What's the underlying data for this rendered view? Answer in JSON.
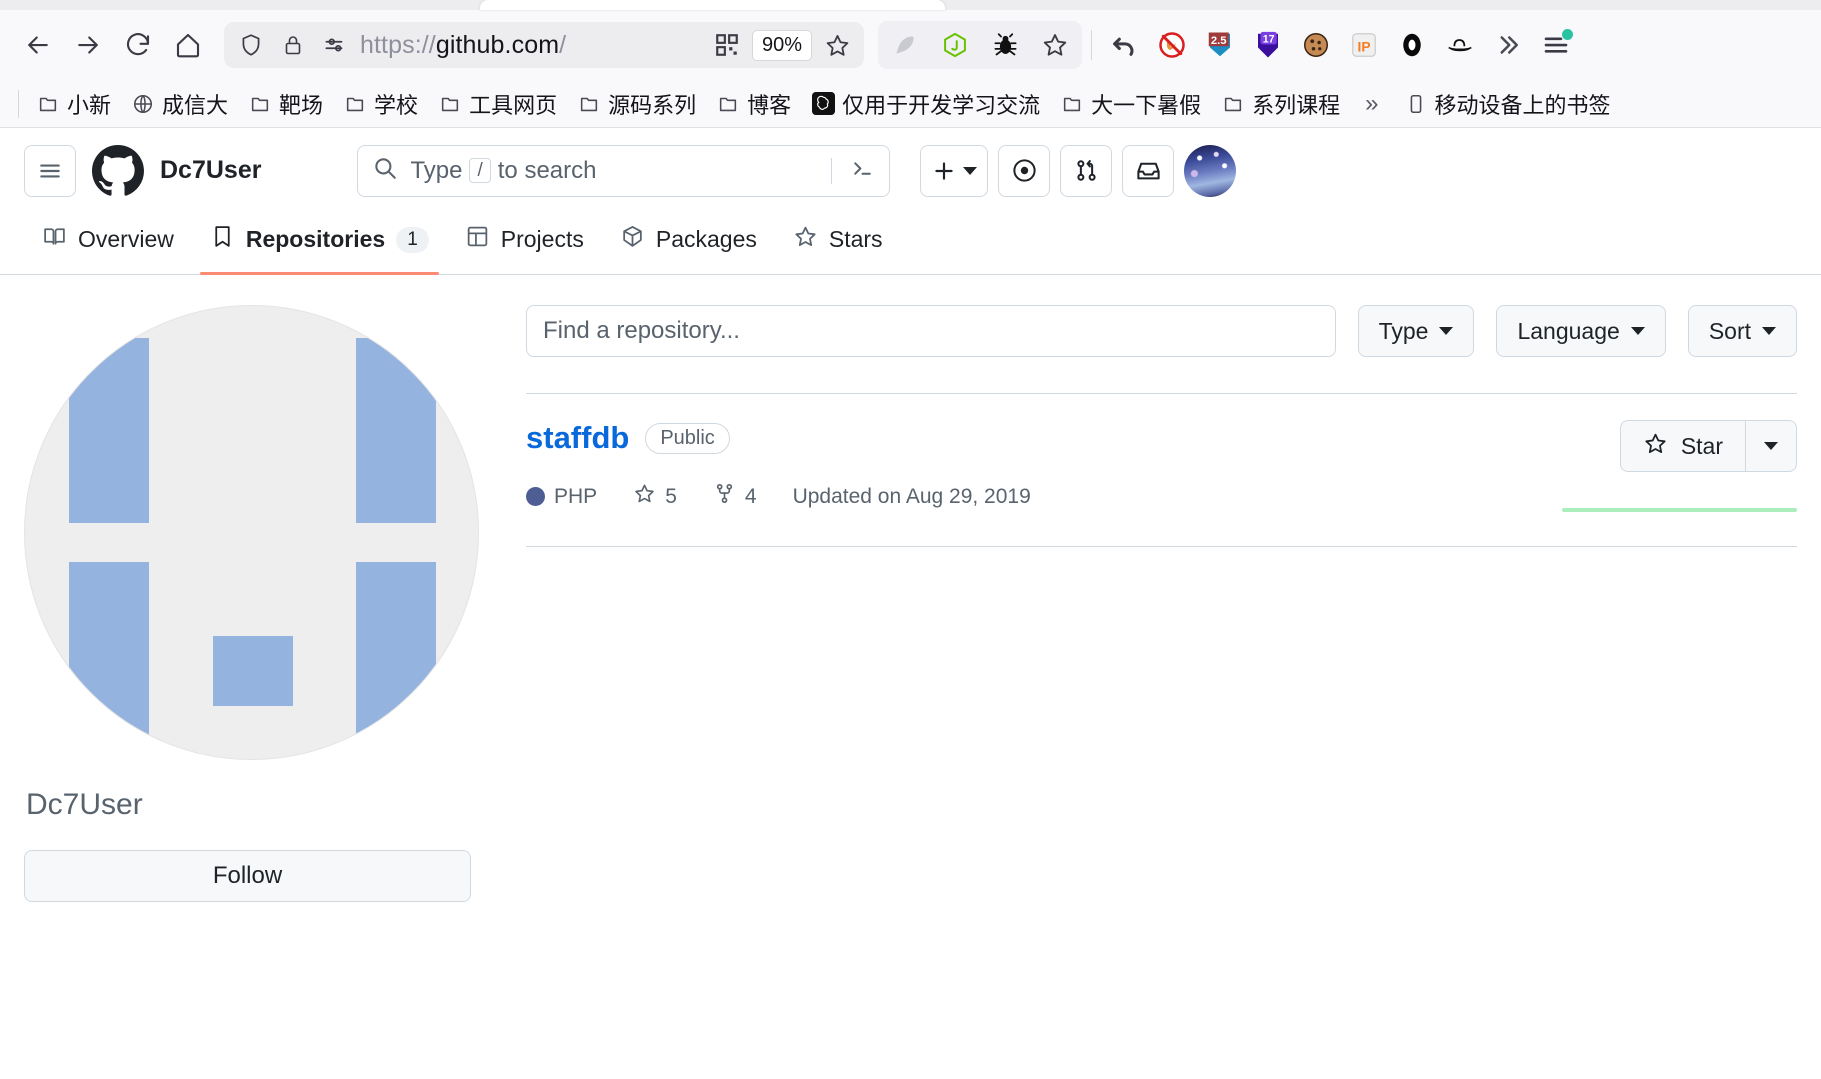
{
  "browser": {
    "nav_buttons": [
      {
        "name": "back-button",
        "icon": "arrow-left-icon"
      },
      {
        "name": "forward-button",
        "icon": "arrow-right-icon"
      },
      {
        "name": "reload-button",
        "icon": "reload-icon"
      },
      {
        "name": "home-button",
        "icon": "home-icon"
      }
    ],
    "url": {
      "scheme": "https://",
      "host": "github.com",
      "trailing_slash": "/",
      "full": "https://github.com/"
    },
    "zoom_level": "90%",
    "urlbar_icons": [
      "shield-icon",
      "lock-icon",
      "permissions-icon"
    ],
    "urlbar_right_icons": [
      "qr-code-icon",
      "bookmark-star-icon"
    ],
    "extension_group": [
      {
        "name": "extension-gray-feather-icon",
        "glyph": "🪶"
      },
      {
        "name": "extension-nodejs-icon",
        "glyph": "JS"
      },
      {
        "name": "extension-bug-icon",
        "glyph": "🐞"
      },
      {
        "name": "extension-star-icon",
        "glyph": "☆"
      }
    ],
    "toolbar_extensions": [
      {
        "name": "undo-close-tab-icon",
        "glyph": "↶"
      },
      {
        "name": "block-fox-icon",
        "glyph": "🚫"
      },
      {
        "name": "badge-250-icon",
        "glyph": "2.50"
      },
      {
        "name": "badge-17-icon",
        "glyph": "17"
      },
      {
        "name": "cookie-icon",
        "glyph": "🍪"
      },
      {
        "name": "ip-extension-icon",
        "glyph": "IP"
      },
      {
        "name": "dark-ring-icon",
        "glyph": "⬬"
      },
      {
        "name": "hat-icon",
        "glyph": "🎩"
      },
      {
        "name": "overflow-chevrons-icon",
        "glyph": "»"
      },
      {
        "name": "app-menu-icon",
        "glyph": "☰"
      }
    ],
    "bookmarks": [
      {
        "label": "小新",
        "icon": "folder-icon"
      },
      {
        "label": "成信大",
        "icon": "globe-icon"
      },
      {
        "label": "靶场",
        "icon": "folder-icon"
      },
      {
        "label": "学校",
        "icon": "folder-icon"
      },
      {
        "label": "工具网页",
        "icon": "folder-icon"
      },
      {
        "label": "源码系列",
        "icon": "folder-icon"
      },
      {
        "label": "博客",
        "icon": "folder-icon"
      },
      {
        "label": "仅用于开发学习交流",
        "icon": "openai-icon"
      },
      {
        "label": "大一下暑假",
        "icon": "folder-icon"
      },
      {
        "label": "系列课程",
        "icon": "folder-icon"
      }
    ],
    "bookmarks_overflow": "»",
    "mobile_bookmarks": {
      "label": "移动设备上的书签",
      "icon": "phone-icon"
    }
  },
  "github": {
    "header": {
      "hamburger_icon": "hamburger-icon",
      "logo_icon": "github-mark-icon",
      "username": "Dc7User",
      "search_placeholder": "Type",
      "search_slash_key": "/",
      "search_placeholder_tail": "to search",
      "search_terminal_icon": "command-palette-icon",
      "create_new_label": "+",
      "actions": [
        {
          "name": "create-new-button",
          "icon": "plus-icon"
        },
        {
          "name": "issues-button",
          "icon": "issue-opened-icon"
        },
        {
          "name": "pull-requests-button",
          "icon": "git-pull-request-icon"
        },
        {
          "name": "notifications-button",
          "icon": "inbox-icon"
        },
        {
          "name": "profile-avatar-button",
          "icon": "avatar"
        }
      ]
    },
    "tabs": [
      {
        "label": "Overview",
        "icon": "book-icon",
        "count": null,
        "active": false
      },
      {
        "label": "Repositories",
        "icon": "repo-icon",
        "count": "1",
        "active": true
      },
      {
        "label": "Projects",
        "icon": "project-icon",
        "count": null,
        "active": false
      },
      {
        "label": "Packages",
        "icon": "package-icon",
        "count": null,
        "active": false
      },
      {
        "label": "Stars",
        "icon": "star-icon",
        "count": null,
        "active": false
      }
    ],
    "profile": {
      "avatar_icon": "identicon-avatar",
      "display_name": "Dc7User",
      "follow_button_label": "Follow"
    },
    "filters": {
      "find_placeholder": "Find a repository...",
      "type_label": "Type",
      "language_label": "Language",
      "sort_label": "Sort"
    },
    "repositories": [
      {
        "name": "staffdb",
        "visibility": "Public",
        "language": "PHP",
        "language_color": "#4f5d95",
        "stars": "5",
        "forks": "4",
        "updated": "Updated on Aug 29, 2019",
        "star_button_label": "Star",
        "activity_color": "#aceebb"
      }
    ]
  },
  "colors": {
    "accent_link": "#0969da",
    "tab_underline": "#fd8c73",
    "identicon_block": "#94b3de",
    "identicon_bg": "#eeeeee",
    "border": "#d1d9e0"
  }
}
